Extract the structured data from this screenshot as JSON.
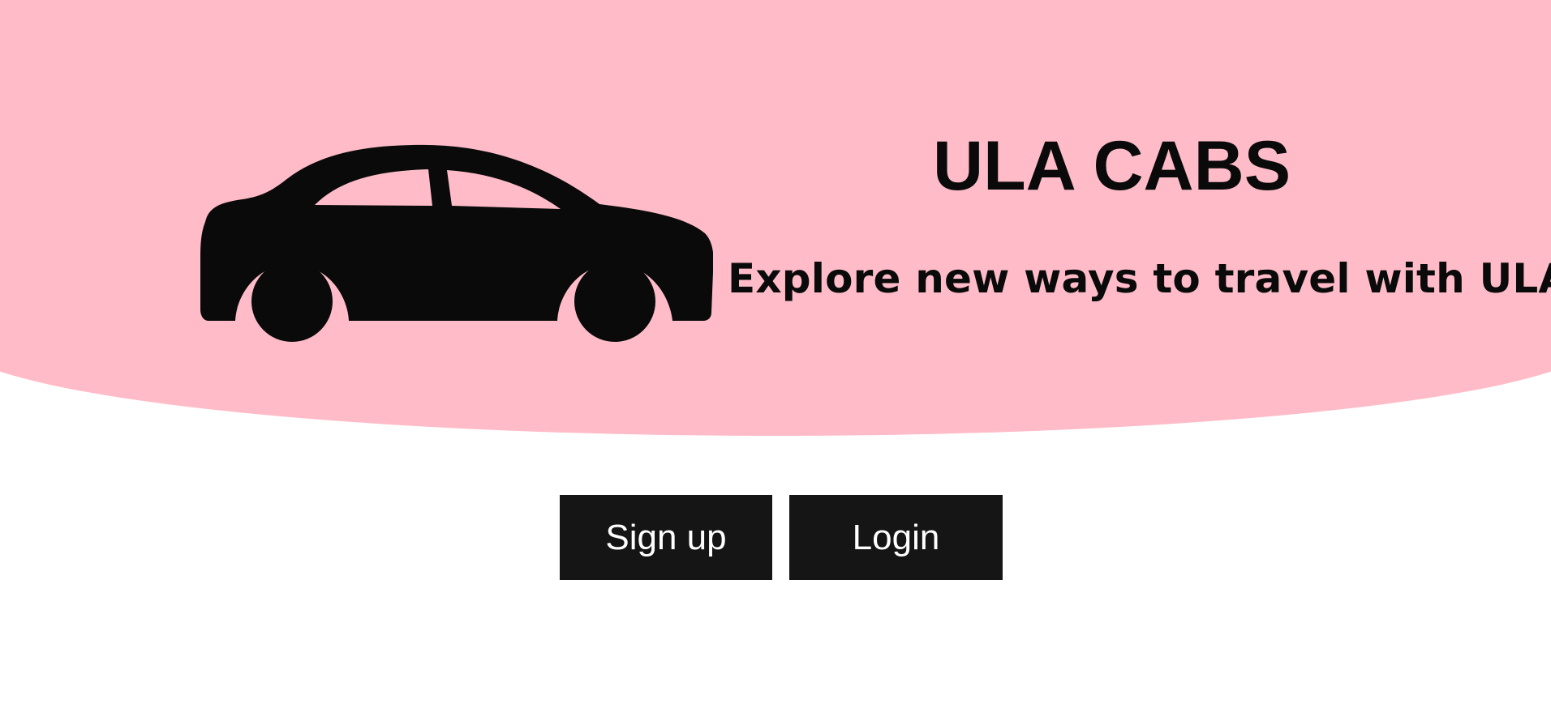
{
  "header": {
    "logo_icon": "car-icon",
    "title": "ULA CABS",
    "tagline": "Explore new ways to travel with ULA!"
  },
  "actions": {
    "signup_label": "Sign up",
    "login_label": "Login"
  },
  "colors": {
    "hero_background": "#ffbcc8",
    "button_background": "#151515",
    "button_text": "#ffffff",
    "text": "#0a0a0a"
  }
}
